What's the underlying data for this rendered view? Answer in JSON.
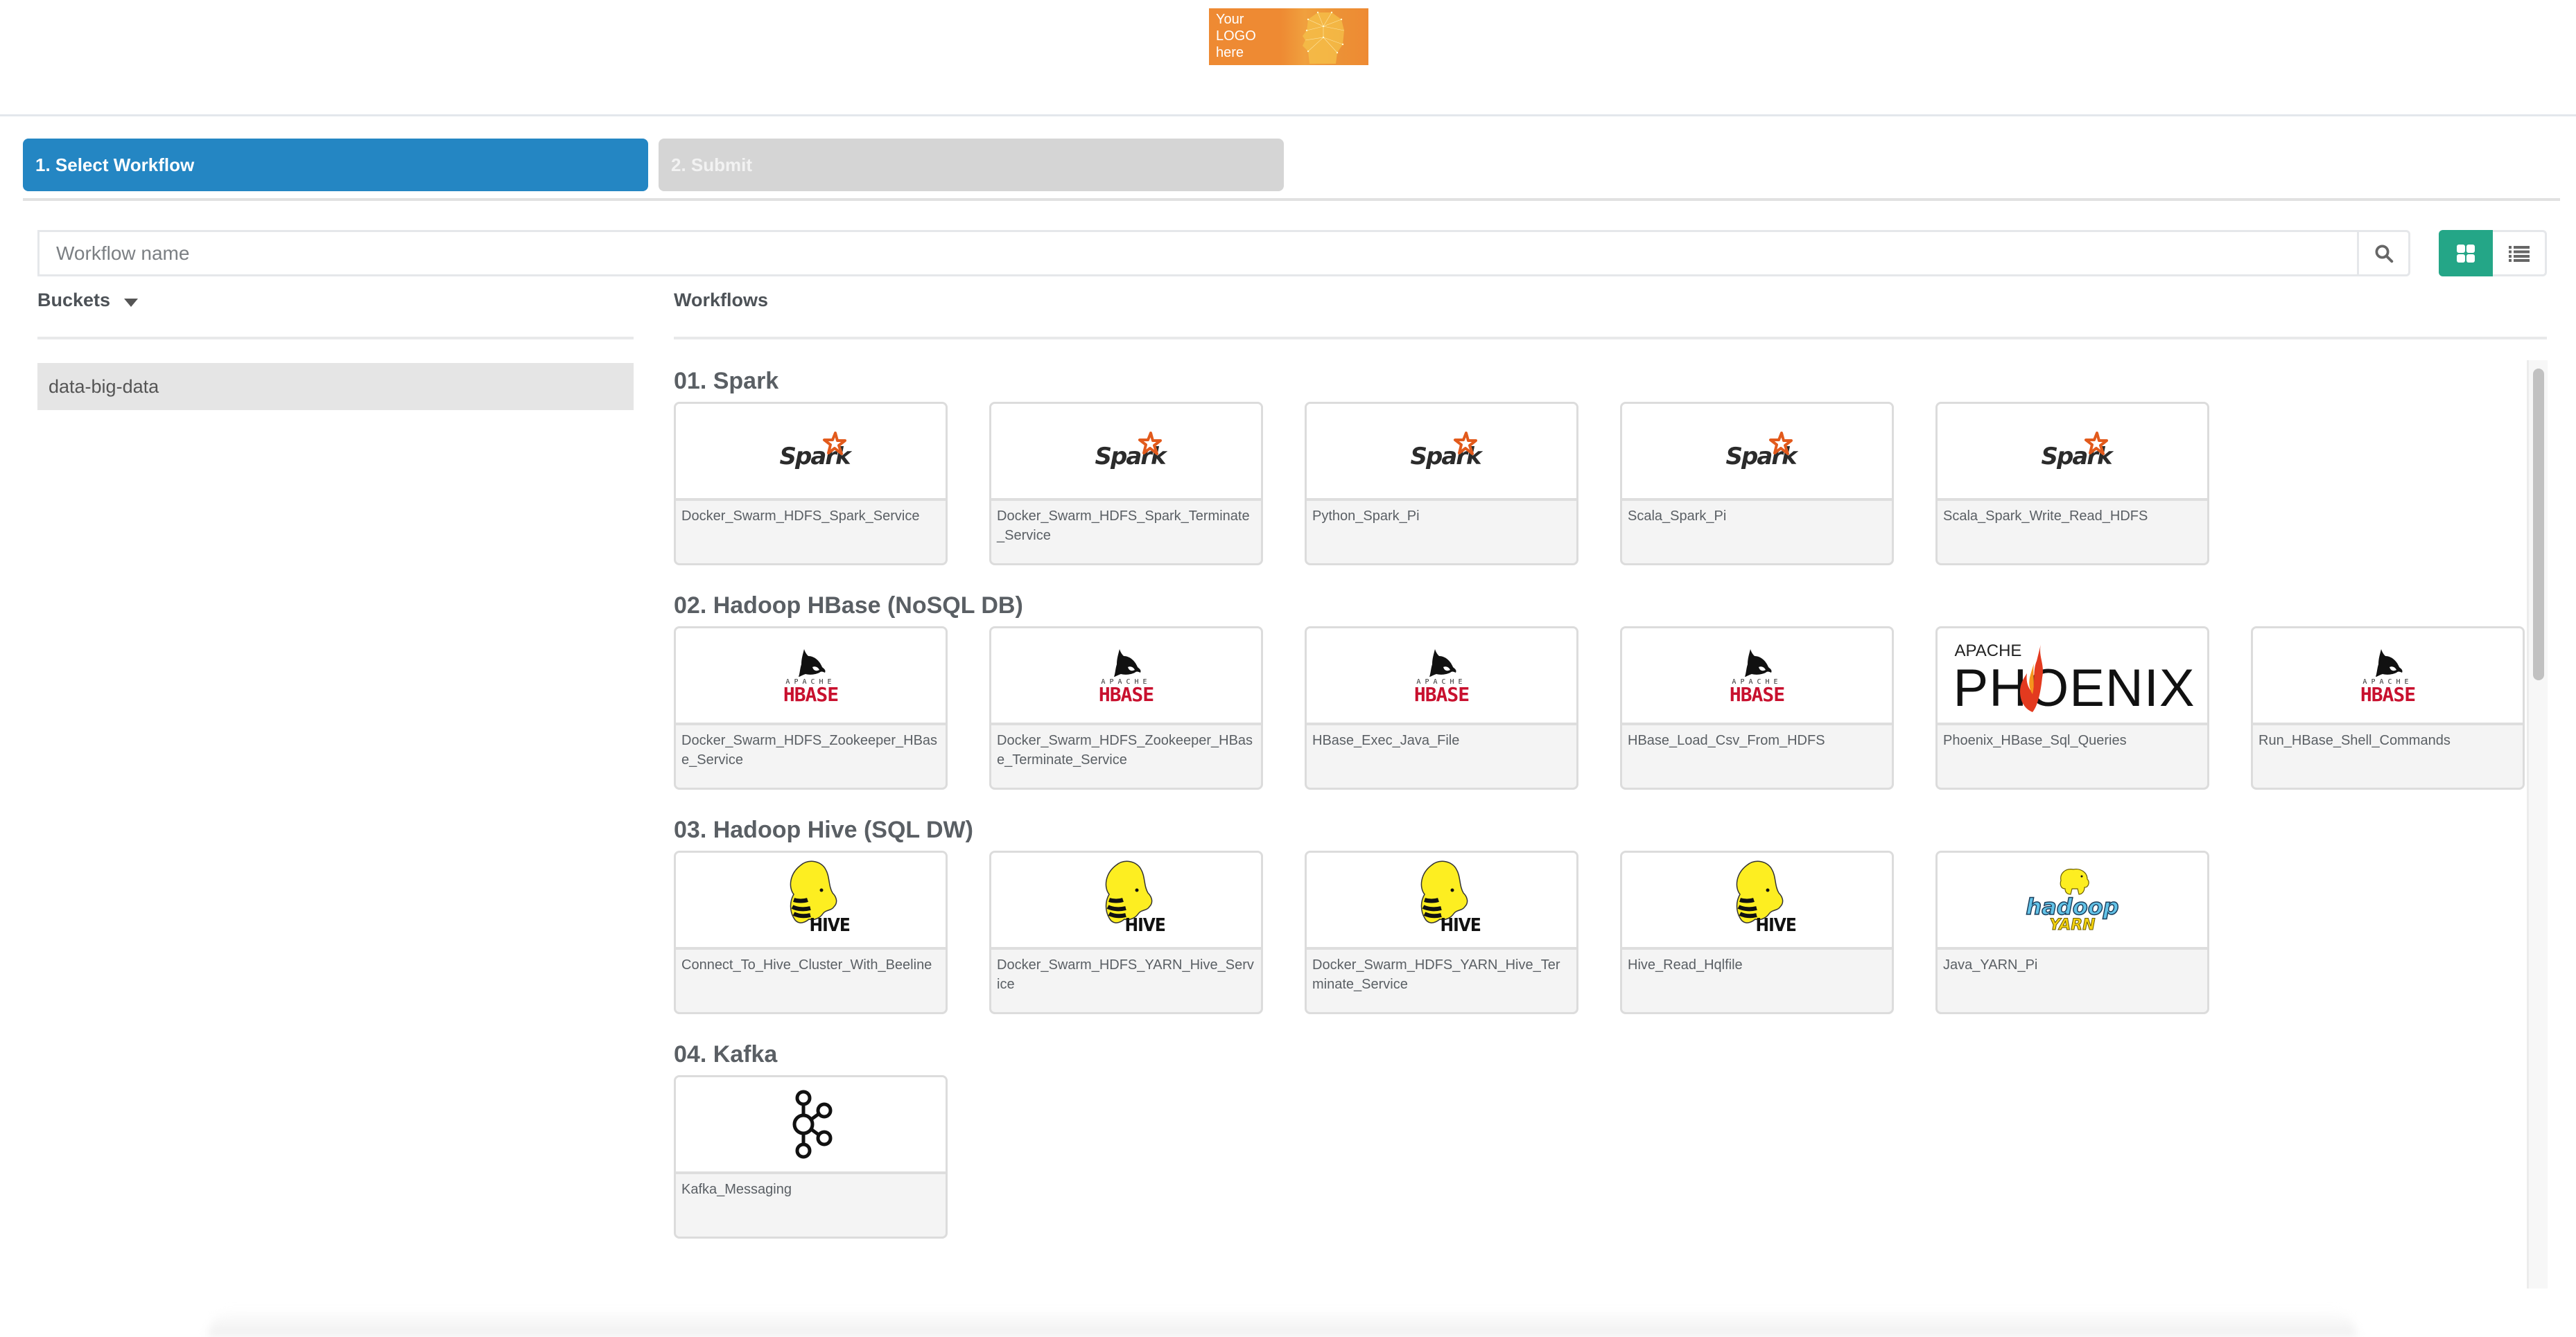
{
  "header": {
    "logo_text": "Your LOGO here"
  },
  "steps": [
    {
      "label": "1. Select Workflow",
      "active": true
    },
    {
      "label": "2. Submit",
      "active": false
    }
  ],
  "search": {
    "placeholder": "Workflow name",
    "value": ""
  },
  "view_modes": {
    "active": "grid",
    "options": [
      "grid",
      "list"
    ]
  },
  "buckets": {
    "title": "Buckets",
    "items": [
      {
        "label": "data-big-data",
        "selected": true
      }
    ]
  },
  "workflows": {
    "title": "Workflows",
    "sections": [
      {
        "title": "01. Spark",
        "items": [
          {
            "name": "Docker_Swarm_HDFS_Spark_Service",
            "logo": "spark"
          },
          {
            "name": "Docker_Swarm_HDFS_Spark_Terminate_Service",
            "logo": "spark"
          },
          {
            "name": "Python_Spark_Pi",
            "logo": "spark"
          },
          {
            "name": "Scala_Spark_Pi",
            "logo": "spark"
          },
          {
            "name": "Scala_Spark_Write_Read_HDFS",
            "logo": "spark"
          }
        ]
      },
      {
        "title": "02. Hadoop HBase (NoSQL DB)",
        "items": [
          {
            "name": "Docker_Swarm_HDFS_Zookeeper_HBase_Service",
            "logo": "hbase"
          },
          {
            "name": "Docker_Swarm_HDFS_Zookeeper_HBase_Terminate_Service",
            "logo": "hbase"
          },
          {
            "name": "HBase_Exec_Java_File",
            "logo": "hbase"
          },
          {
            "name": "HBase_Load_Csv_From_HDFS",
            "logo": "hbase"
          },
          {
            "name": "Phoenix_HBase_Sql_Queries",
            "logo": "phoenix"
          },
          {
            "name": "Run_HBase_Shell_Commands",
            "logo": "hbase"
          }
        ]
      },
      {
        "title": "03. Hadoop Hive (SQL DW)",
        "items": [
          {
            "name": "Connect_To_Hive_Cluster_With_Beeline",
            "logo": "hive"
          },
          {
            "name": "Docker_Swarm_HDFS_YARN_Hive_Service",
            "logo": "hive"
          },
          {
            "name": "Docker_Swarm_HDFS_YARN_Hive_Terminate_Service",
            "logo": "hive"
          },
          {
            "name": "Hive_Read_Hqlfile",
            "logo": "hive"
          },
          {
            "name": "Java_YARN_Pi",
            "logo": "hadoop-yarn"
          }
        ]
      },
      {
        "title": "04. Kafka",
        "items": [
          {
            "name": "Kafka_Messaging",
            "logo": "kafka"
          }
        ]
      }
    ]
  },
  "logo_text": {
    "spark": "Spark",
    "hbase_apache": "APACHE",
    "hbase": "HBASE",
    "phoenix_apache": "APACHE",
    "phoenix": "PHOENIX",
    "hive": "HIVE",
    "hadoop": "hadoop",
    "yarn": "YARN"
  },
  "colors": {
    "primary": "#2486c3",
    "accent_green": "#24a687",
    "step_inactive": "#d5d5d5",
    "logo_orange": "#ee8a33"
  }
}
